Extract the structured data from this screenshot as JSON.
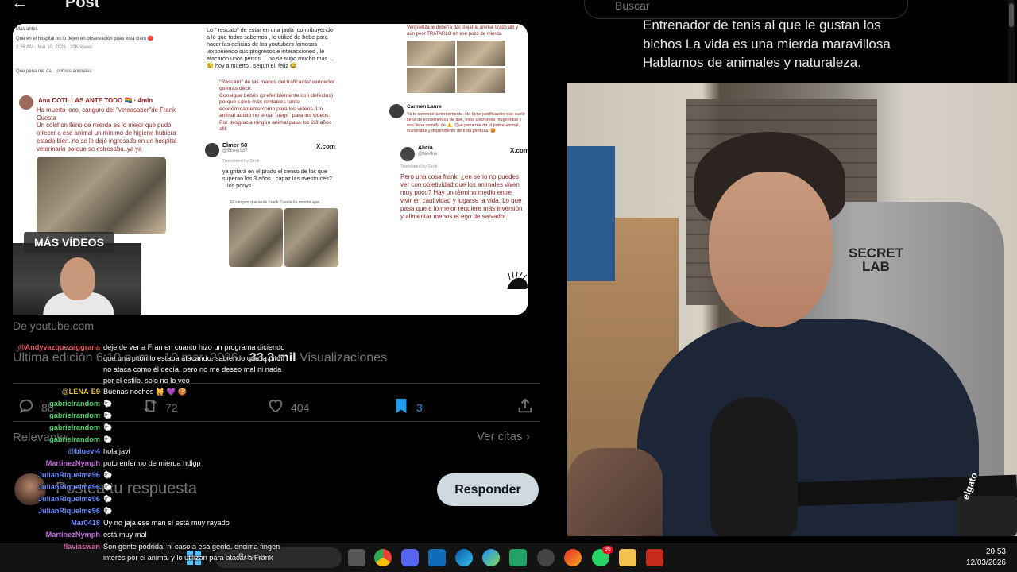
{
  "post": {
    "back": "←",
    "title": "Post",
    "media": {
      "col1": {
        "header_lines": [
          "Más antes",
          "Que en el hospital no lo dejen en observación pues está claro 🔴",
          "3:26 AM · Mar 10, 2026 · 30K Views"
        ],
        "reply_line": "Que pena me da... pobres animales",
        "tweet_name": "Ana COTILLAS ANTE TODO 🏳️‍🌈 · 4min",
        "tweet_text": "Ha muerto loco, canguro del \"veteasaber\"de Frank Cuesta\nUn colchon lleno de mierda es lo mejor que pudo ofrecer a ese animal un mínimo de higiene hubiera estado bien..no se le dejó ingresado en un hospital veterinario porque se estresaba..ya ya"
      },
      "col2": {
        "top_text": "Lo \" rescato\" de estar en una jaula ,contribuyendo a lo que todos sabemos , lo utilizó de bebe para hacer las delicias de los youtubers famosos ,exponiendo sus progresos e interacciones , le atacaron unos perros ... no se supo mucho mas ... 😢 hoy a muerto , segun el, feliz 😂",
        "quote_text": "\"Rescato\" de las manos del traficante/ vendedor querrás decir.\nConsigue bebés (preferiblemente con defectos) porque salen más rentables tanto económicamente como para los videos. Un animal adulto no le da \"juego\" para los videos.\nPor desgracia ningún animal pasa los 2/3 años allí.",
        "user_name": "Elmer 58",
        "user_handle": "@Elmer587",
        "xcom": "X.com",
        "translated": "Translated by Grok",
        "reply": "ya gritará en el prado el censo de los que superan los 3 años...capaz las avestruces? ...los ponys",
        "bottom_text": "El canguro que tenía Frank Cuesta ha muerto ayer..."
      },
      "col3": {
        "top_text": "Vergüenza le debería dar, dejar al animal tirado allí y aún peor TRATARLO en ese pozo de mierda.",
        "carmen_name": "Carmen Laure",
        "carmen_text": "Ya lo comenté anteriormente. No tiene justificación ese suelo lleno de excrementos de ave, esos colchones mugrientos y esa llona comida de ⚠️. Que pena me da el pobre animal, vulnerable y dependiente de esta gentuza. 😡",
        "alicia_name": "Alicia",
        "alicia_handle": "@falvilux",
        "xcom": "X.com",
        "translated": "Translated by Grok",
        "alicia_text": "Pero una cosa frank, ¿en serio no puedes ver con objetividad que los animales viven muy poco? Hay un término medio entre vivir en cautividad y jugarse la vida. Lo que pasa que a lo mejor requiere más inversión y alimentar menos el ego de salvador."
      }
    },
    "mas_videos": "MÁS VÍDEOS",
    "source": "De youtube.com",
    "edit_prefix": "Última edición 6:10 p. m. · 10 mar. 2026 · ",
    "views_count": "33,3 mil",
    "views_label": " Visualizaciones",
    "actions": {
      "replies": "88",
      "reposts": "72",
      "likes": "404",
      "bookmarks": "3"
    },
    "relevant": "Relevante ⌄",
    "quotes": "Ver citas ›",
    "reply_placeholder": "Postea tu respuesta",
    "reply_button": "Responder"
  },
  "chat": [
    {
      "user": "@Andyvazquezaggrana",
      "color": "#e05a5a",
      "text": "deje de ver a Fran en cuanto hizo un programa diciendo que una pitón lo estaba atacando, sabiendo que la pitón no ataca como él decía. pero no me deseo mal ni nada por el estilo. solo no lo veo",
      "multi": true
    },
    {
      "user": "@LENA-E9",
      "color": "#e6c44a",
      "text": "Buenas noches 🙀 💜 🍪"
    },
    {
      "user": "gabrielrandom",
      "color": "#4fd36a",
      "text": "🐑"
    },
    {
      "user": "gabrielrandom",
      "color": "#4fd36a",
      "text": "🐑"
    },
    {
      "user": "gabrielrandom",
      "color": "#4fd36a",
      "text": "🐑"
    },
    {
      "user": "gabrielrandom",
      "color": "#4fd36a",
      "text": "🐑"
    },
    {
      "user": "@bluevi4",
      "color": "#6a8cff",
      "text": "hola javi"
    },
    {
      "user": "MartinezNymph",
      "color": "#c86be0",
      "text": "puto enfermo de mierda hdlgp"
    },
    {
      "user": "JulianRiquelme96",
      "color": "#6a8cff",
      "text": "🐑"
    },
    {
      "user": "JulianRiquelme96",
      "color": "#6a8cff",
      "text": "🐑"
    },
    {
      "user": "JulianRiquelme96",
      "color": "#6a8cff",
      "text": "🐑"
    },
    {
      "user": "JulianRiquelme96",
      "color": "#6a8cff",
      "text": "🐑"
    },
    {
      "user": "Mar0418",
      "color": "#6a8cff",
      "text": "Uy no jaja ese man sí está muy rayado"
    },
    {
      "user": "MartinezNymph",
      "color": "#c86be0",
      "text": "está muy mal"
    },
    {
      "user": "flaviaswan",
      "color": "#e06bb0",
      "text": "Son gente podrida, ni caso a esa gente. encima fingen interés por el animal y lo utilizan para atacar a Frank",
      "multi": true
    }
  ],
  "sidebar": {
    "search_placeholder": "Buscar",
    "bio": "Entrenador de tenis al que le gustan los bichos La vida es una mierda maravillosa Hablamos de animales y naturaleza."
  },
  "webcam": {
    "chair_brand": "SECRET\nLAB",
    "camera_label": "elgato"
  },
  "taskbar": {
    "search": "Buscar",
    "badge": "95",
    "time": "20:53",
    "date": "12/03/2026"
  },
  "colors": {
    "x_bg": "#000000",
    "bookmark_blue": "#1d9bf0",
    "muted": "#71767b"
  }
}
